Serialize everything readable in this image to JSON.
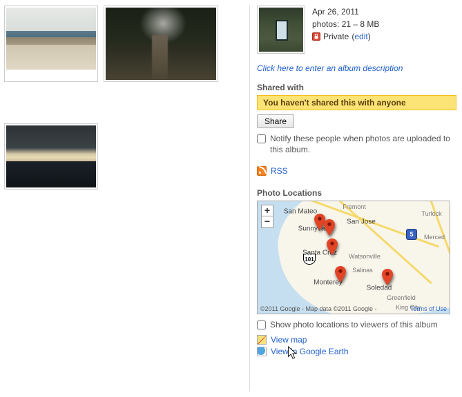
{
  "album": {
    "date": "Apr 26, 2011",
    "photos_line": "photos: 21 – 8 MB",
    "privacy_label": "Private",
    "privacy_edit": "edit",
    "description_prompt": "Click here to enter an album description"
  },
  "sharing": {
    "title": "Shared with",
    "banner": "You haven't shared this with anyone",
    "share_button": "Share",
    "notify_label": "Notify these people when photos are uploaded to this album."
  },
  "rss": {
    "label": "RSS"
  },
  "locations": {
    "title": "Photo Locations",
    "zoom_in": "+",
    "zoom_out": "−",
    "shield_101": "101",
    "shield_5": "5",
    "labels": {
      "san_mateo": "San Mateo",
      "sunnyvale": "Sunnyvale",
      "fremont": "Fremont",
      "san_jose": "San Jose",
      "santa_cruz": "Santa Cruz",
      "watsonville": "Watsonville",
      "salinas": "Salinas",
      "monterey": "Monterey",
      "soledad": "Soledad",
      "greenfield": "Greenfield",
      "king_city": "King City",
      "turlock": "Turlock",
      "merced": "Merced"
    },
    "copyright": "©2011 Google - Map data ©2011 Google -",
    "terms": "Terms of Use",
    "show_locations_label": "Show photo locations to viewers of this album",
    "view_map": "View map",
    "view_earth": "View in Google Earth"
  }
}
